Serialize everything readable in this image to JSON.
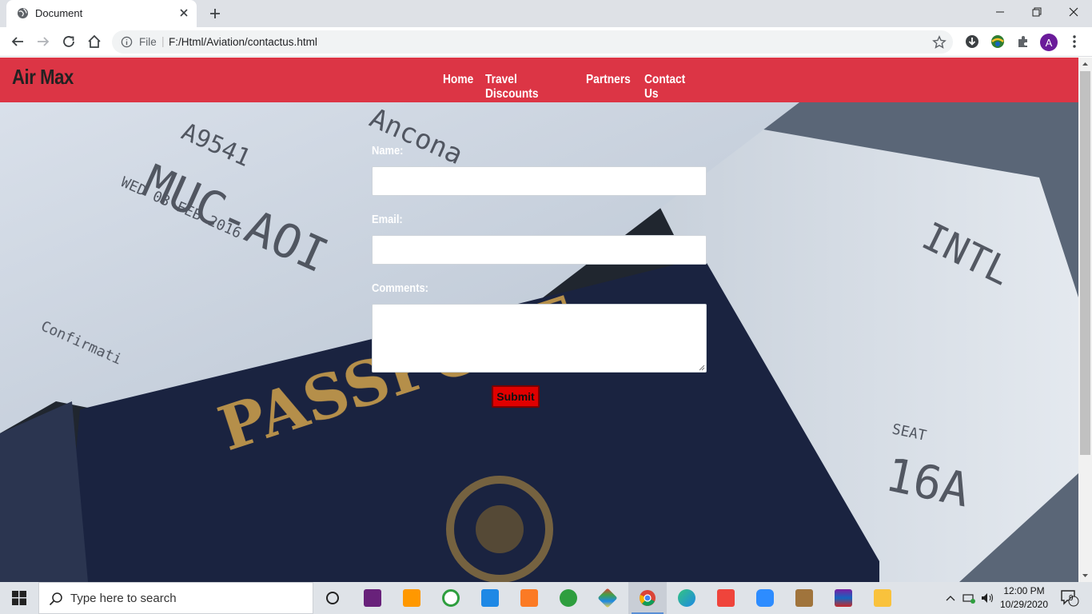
{
  "browser": {
    "tab_title": "Document",
    "address_scheme": "File",
    "address_url": "F:/Html/Aviation/contactus.html",
    "profile_initial": "A"
  },
  "site": {
    "brand": "Air Max",
    "nav": [
      "Home",
      "Travel Discounts",
      "Partners",
      "Contact Us"
    ],
    "accent_color": "#dc3545"
  },
  "form": {
    "name_label": "Name:",
    "email_label": "Email:",
    "comments_label": "Comments:",
    "submit_label": "Submit"
  },
  "taskbar": {
    "search_placeholder": "Type here to search",
    "time": "12:00 PM",
    "date": "10/29/2020",
    "notification_count": "9"
  }
}
